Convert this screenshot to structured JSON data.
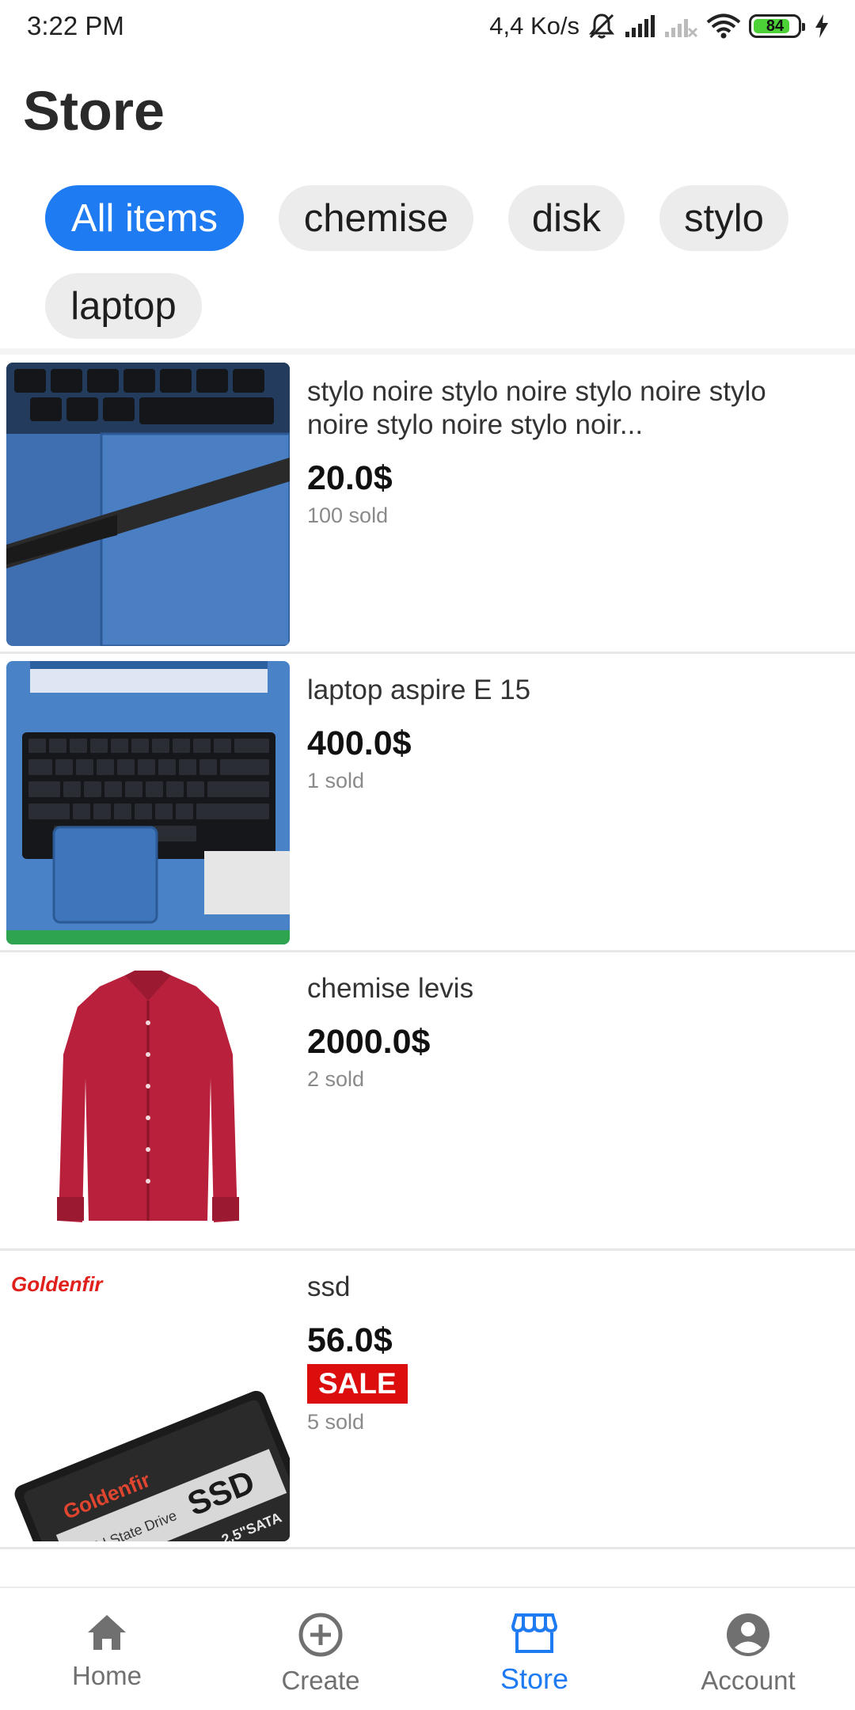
{
  "status_bar": {
    "time": "3:22 PM",
    "speed": "4,4 Ko/s",
    "battery": "84"
  },
  "page": {
    "title": "Store"
  },
  "filters": [
    {
      "label": "All items",
      "active": true
    },
    {
      "label": "chemise",
      "active": false
    },
    {
      "label": "disk",
      "active": false
    },
    {
      "label": "stylo",
      "active": false
    },
    {
      "label": "laptop",
      "active": false
    }
  ],
  "products": [
    {
      "title": "stylo noire stylo noire stylo noire stylo noire stylo noire stylo noir...",
      "price": "20.0$",
      "sold": "100 sold",
      "image": "pen-on-laptop-photo"
    },
    {
      "title": "laptop aspire E 15",
      "price": "400.0$",
      "sold": "1 sold",
      "image": "blue-laptop-photo"
    },
    {
      "title": "chemise levis",
      "price": "2000.0$",
      "sold": "2 sold",
      "image": "red-shirt-photo"
    },
    {
      "title": "ssd",
      "price": "56.0$",
      "badge": "SALE",
      "sold": "5 sold",
      "image": "ssd-photo",
      "image_text": {
        "brand": "Goldenfir",
        "label": "SSD",
        "sub": "Solid State Drive",
        "size": "2.5\"SATA"
      }
    }
  ],
  "nav": {
    "items": [
      {
        "label": "Home",
        "icon": "home-icon",
        "active": false
      },
      {
        "label": "Create",
        "icon": "add-circle-icon",
        "active": false
      },
      {
        "label": "Store",
        "icon": "store-icon",
        "active": true
      },
      {
        "label": "Account",
        "icon": "account-icon",
        "active": false
      }
    ]
  },
  "colors": {
    "accent": "#1f7bf2",
    "chip_bg": "#ececec",
    "sale": "#dc0d0d"
  }
}
